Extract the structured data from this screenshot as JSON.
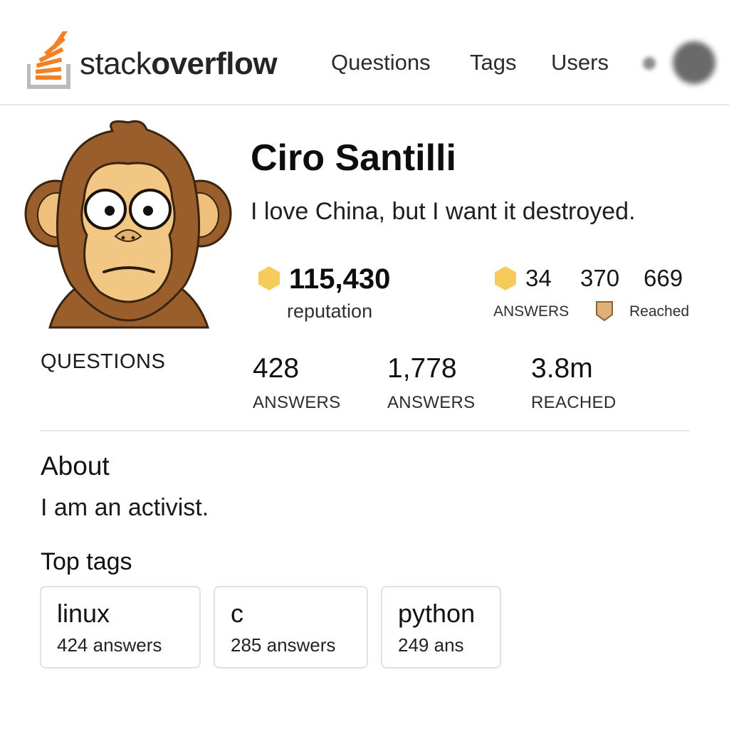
{
  "header": {
    "logo_text_regular": "stack",
    "logo_text_bold": "overflow",
    "nav": [
      "Questions",
      "Tags",
      "Users"
    ]
  },
  "profile": {
    "name": "Ciro Santilli",
    "tagline": "I love China, but I want it destroyed.",
    "reputation_value": "115,430",
    "reputation_label": "reputation",
    "mini_stats": {
      "answers_num": "34",
      "num_370": "370",
      "num_669": "669",
      "answers_label": "ANSWERS",
      "reached_label": "Reached"
    }
  },
  "stats": {
    "questions_label": "QUESTIONS",
    "items": [
      {
        "value": "428",
        "label": "ANSWERS"
      },
      {
        "value": "1,778",
        "label": "ANSWERS"
      },
      {
        "value": "3.8m",
        "label": "REACHED"
      }
    ]
  },
  "about": {
    "title": "About",
    "text": "I am an activist."
  },
  "top_tags": {
    "title": "Top tags",
    "tags": [
      {
        "name": "linux",
        "count": "424 answers"
      },
      {
        "name": "c",
        "count": "285 answers"
      },
      {
        "name": "python",
        "count": "249 ans"
      }
    ]
  },
  "colors": {
    "brand_orange": "#f48024",
    "gold_badge": "#f5cc5c",
    "bronze_badge": "#e0b07a",
    "divider": "#e4e6e8"
  },
  "icons": [
    "stackoverflow-logo-icon",
    "gold-badge-icon",
    "bronze-badge-icon",
    "monkey-avatar"
  ]
}
